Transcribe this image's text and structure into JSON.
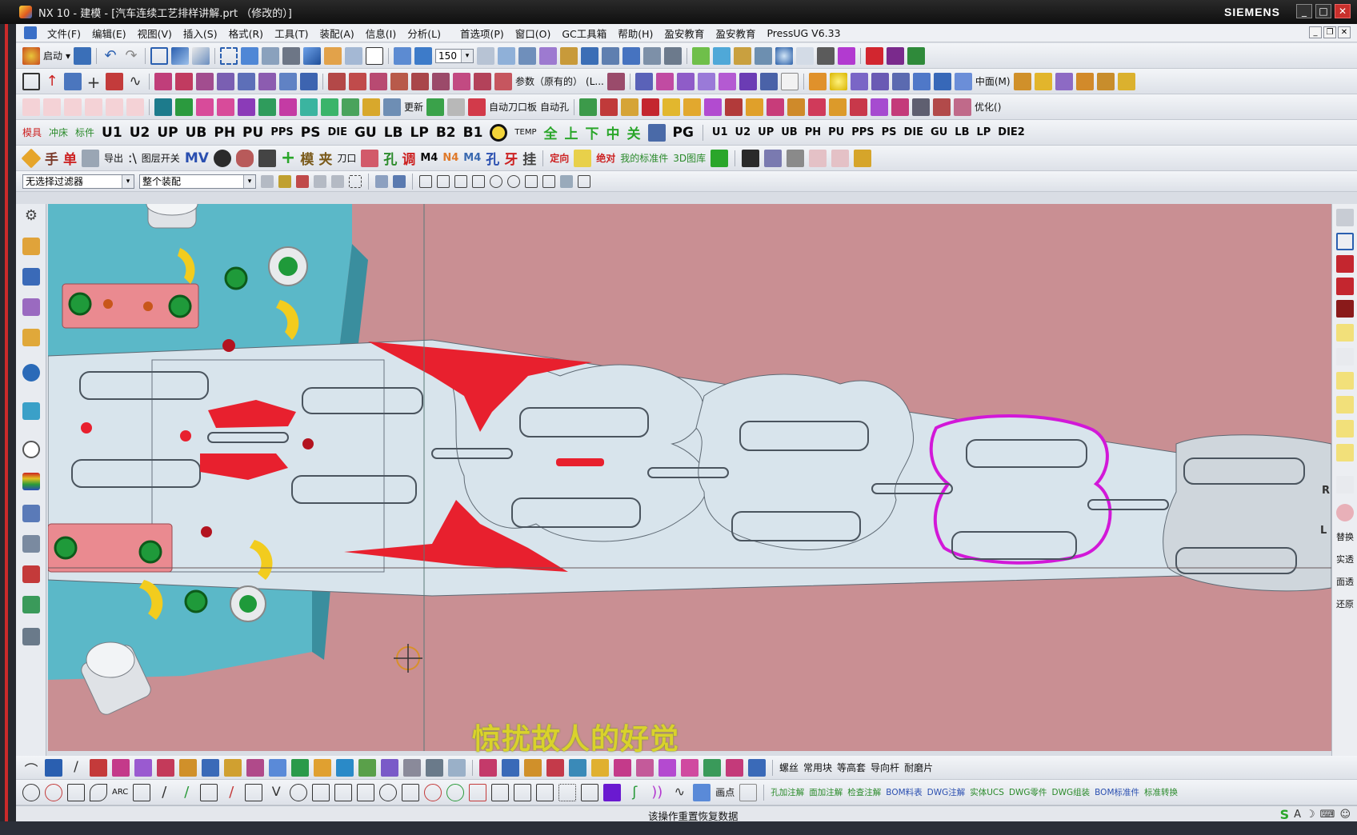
{
  "window": {
    "title": "NX 10 - 建模 - [汽车连续工艺排样讲解.prt （修改的）]",
    "brand": "SIEMENS",
    "controls": {
      "minimize": "_",
      "maximize": "□",
      "close": "✕"
    }
  },
  "menu": {
    "items": [
      "文件(F)",
      "编辑(E)",
      "视图(V)",
      "插入(S)",
      "格式(R)",
      "工具(T)",
      "装配(A)",
      "信息(I)",
      "分析(L)",
      "首选项(P)",
      "窗口(O)",
      "GC工具箱",
      "帮助(H)",
      "盈安教育",
      "盈安教育",
      "PressUG V6.33"
    ]
  },
  "toolbar": {
    "start_label": "启动",
    "zoom_value": "150",
    "parameters_label": "参数（原有的）",
    "parameters_suffix": "(L...",
    "midplane_label": "中面(M)",
    "auto_knife_label": "自动刀口板",
    "auto_hole_label": "自动孔",
    "optimize_label": "优化()",
    "update_label": "更新",
    "text_labels_row3": [
      "模具",
      "冲床",
      "标件",
      "导出"
    ],
    "std_parts": [
      "U1",
      "U2",
      "UP",
      "UB",
      "PH",
      "PU",
      "PPS",
      "PS",
      "DIE",
      "GU",
      "LB",
      "LP",
      "B2",
      "B1"
    ],
    "std_parts_small": [
      "U1",
      "U2",
      "UP",
      "UB",
      "PH",
      "PU",
      "PPS",
      "PS",
      "DIE",
      "GU",
      "LB",
      "LP",
      "DIE2"
    ],
    "hanzi_buttons": [
      "全",
      "上",
      "下",
      "中",
      "关"
    ],
    "pg_label": "PG",
    "mv_label": "MV",
    "row5_labels": [
      "导出",
      "图层开关",
      "模",
      "夹",
      "刀口",
      "M4",
      "N4",
      "M4",
      "孔",
      "定向",
      "绝对",
      "我的标准件",
      "3D图库"
    ],
    "filter_value": "无选择过滤器",
    "assembly_value": "整个装配"
  },
  "bottom_toolbar": {
    "row1_labels": [
      "螺丝",
      "常用块",
      "等高套",
      "导向杆",
      "耐磨片"
    ],
    "row2_labels": [
      "ARC",
      "画点",
      "孔加注解",
      "面加注解",
      "检查注解",
      "BOM料表",
      "DWG注解",
      "实体UCS",
      "DWG零件",
      "DWG组装",
      "BOM标准件",
      "标准转换"
    ]
  },
  "right_panel": {
    "labels": [
      "替换",
      "实透",
      "面透",
      "还原"
    ]
  },
  "viewport": {
    "background": "#c98f93",
    "plate_color": "#56b6c6",
    "strip_color": "#d9e4ec",
    "waste_color": "#e8202e",
    "highlight_color": "#d218d8",
    "pad_color": "#ea8a90",
    "axis_labels": [
      "R",
      "L"
    ]
  },
  "subtitle": "惊扰故人的好觉",
  "status": {
    "message": "该操作重置恢复数据"
  }
}
